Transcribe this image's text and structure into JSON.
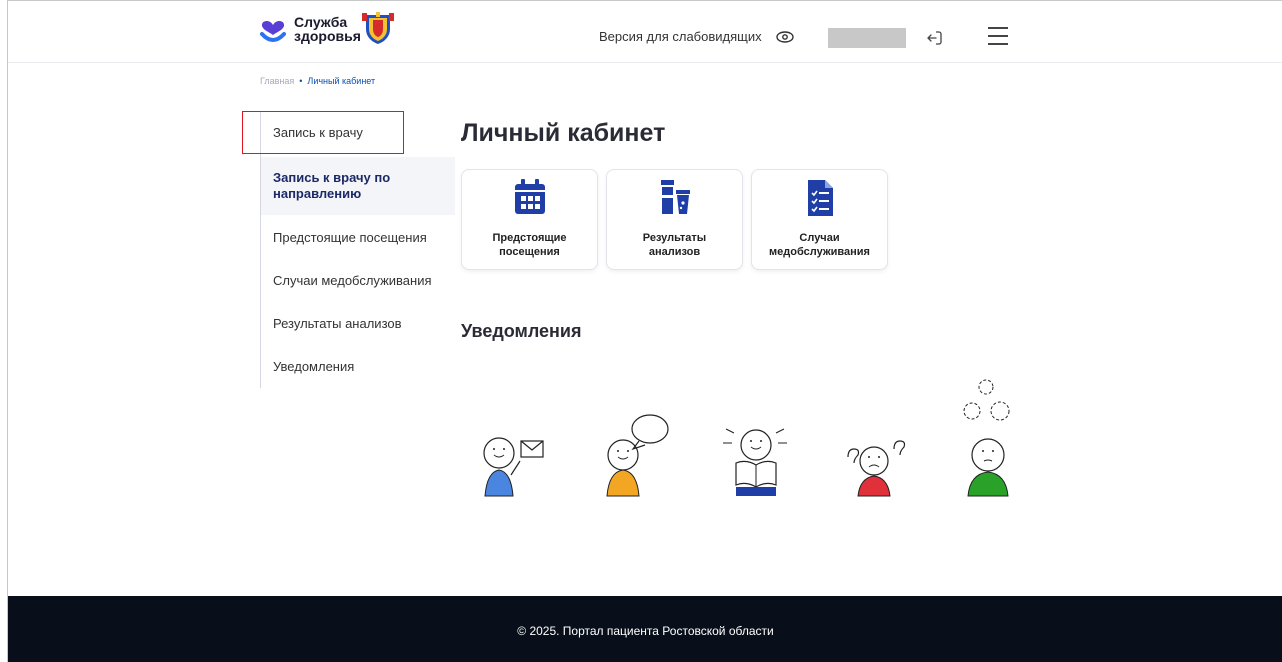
{
  "header": {
    "logo_line1": "Служба",
    "logo_line2": "здоровья",
    "logo_icon": "heart-check-icon",
    "emblem_icon": "rostov-emblem-icon",
    "accessibility_label": "Версия для слабовидящих",
    "accessibility_icon": "eye-icon",
    "logout_icon": "logout-icon",
    "menu_icon": "burger-menu-icon"
  },
  "breadcrumb": {
    "home": "Главная",
    "separator": "•",
    "current": "Личный кабинет"
  },
  "sidebar": {
    "items": [
      {
        "label": "Запись к врачу"
      },
      {
        "label": "Запись к врачу по направлению",
        "active": true
      },
      {
        "label": "Предстоящие посещения"
      },
      {
        "label": "Случаи медобслуживания"
      },
      {
        "label": "Результаты анализов"
      },
      {
        "label": "Уведомления"
      }
    ]
  },
  "main": {
    "title": "Личный кабинет",
    "cards": [
      {
        "label_line1": "Предстоящие",
        "label_line2": "посещения",
        "icon": "calendar-icon"
      },
      {
        "label_line1": "Результаты",
        "label_line2": "анализов",
        "icon": "test-tube-icon"
      },
      {
        "label_line1": "Случаи",
        "label_line2": "медобслуживания",
        "icon": "checklist-document-icon"
      }
    ],
    "notifications_title": "Уведомления"
  },
  "footer": {
    "copyright": "©  2025. Портал пациента Ростовской области"
  },
  "colors": {
    "accent": "#1f3fa6",
    "brand_purple": "#5a3fd6",
    "footer_bg": "#090f1a",
    "highlight_border": "#e0161e"
  }
}
